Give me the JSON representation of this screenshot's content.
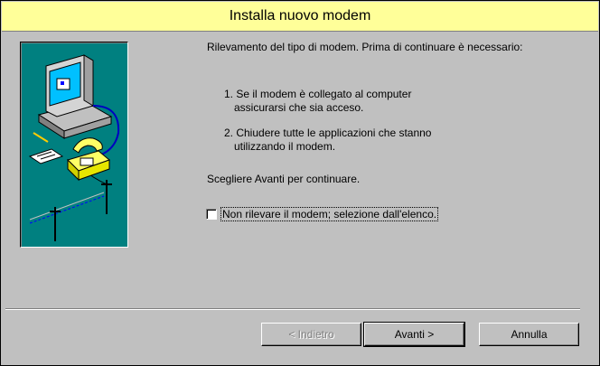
{
  "window": {
    "title": "Installa nuovo modem"
  },
  "content": {
    "intro": "Rilevamento del tipo di modem. Prima di continuare è necessario:",
    "steps": [
      {
        "line1": "1. Se il modem è collegato al computer",
        "line2": "assicurarsi che sia acceso."
      },
      {
        "line1": "2. Chiudere tutte le applicazioni che stanno",
        "line2": "utilizzando il modem."
      }
    ],
    "continue_text": "Scegliere Avanti per continuare."
  },
  "checkbox": {
    "label": "Non rilevare il modem; selezione dall'elenco.",
    "checked": false
  },
  "buttons": {
    "back": {
      "label": "< Indietro",
      "enabled": false
    },
    "next": {
      "label": "Avanti >",
      "enabled": true,
      "default": true
    },
    "cancel": {
      "label": "Annulla",
      "enabled": true
    }
  },
  "illustration": {
    "background": "#008080",
    "icons": [
      "computer-icon",
      "modem-icon",
      "telephone-icon",
      "phone-line-icon",
      "notepad-icon"
    ]
  }
}
